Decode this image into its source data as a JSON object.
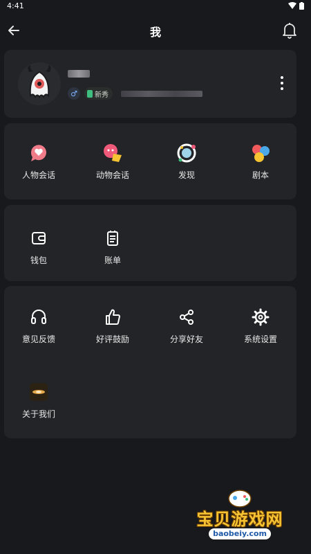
{
  "status": {
    "time": "4:41"
  },
  "header": {
    "title": "我"
  },
  "profile": {
    "gender_symbol": "♂",
    "level": "新秀"
  },
  "chat_menu": [
    {
      "label": "人物会话",
      "icon": "person-chat-icon"
    },
    {
      "label": "动物会话",
      "icon": "animal-chat-icon"
    },
    {
      "label": "发现",
      "icon": "discover-icon"
    },
    {
      "label": "剧本",
      "icon": "script-icon"
    }
  ],
  "wallet_menu": [
    {
      "label": "钱包",
      "icon": "wallet-icon"
    },
    {
      "label": "账单",
      "icon": "bill-icon"
    }
  ],
  "tools_menu": [
    {
      "label": "意见反馈",
      "icon": "headset-icon"
    },
    {
      "label": "好评鼓励",
      "icon": "thumbs-up-icon"
    },
    {
      "label": "分享好友",
      "icon": "share-icon"
    },
    {
      "label": "系统设置",
      "icon": "gear-icon"
    },
    {
      "label": "关于我们",
      "icon": "about-logo-icon"
    }
  ],
  "watermark": {
    "text": "宝贝游戏网",
    "url": "baobeiy.com"
  },
  "colors": {
    "background": "#18191c",
    "card": "#232428",
    "accent_yellow": "#f6c333"
  }
}
